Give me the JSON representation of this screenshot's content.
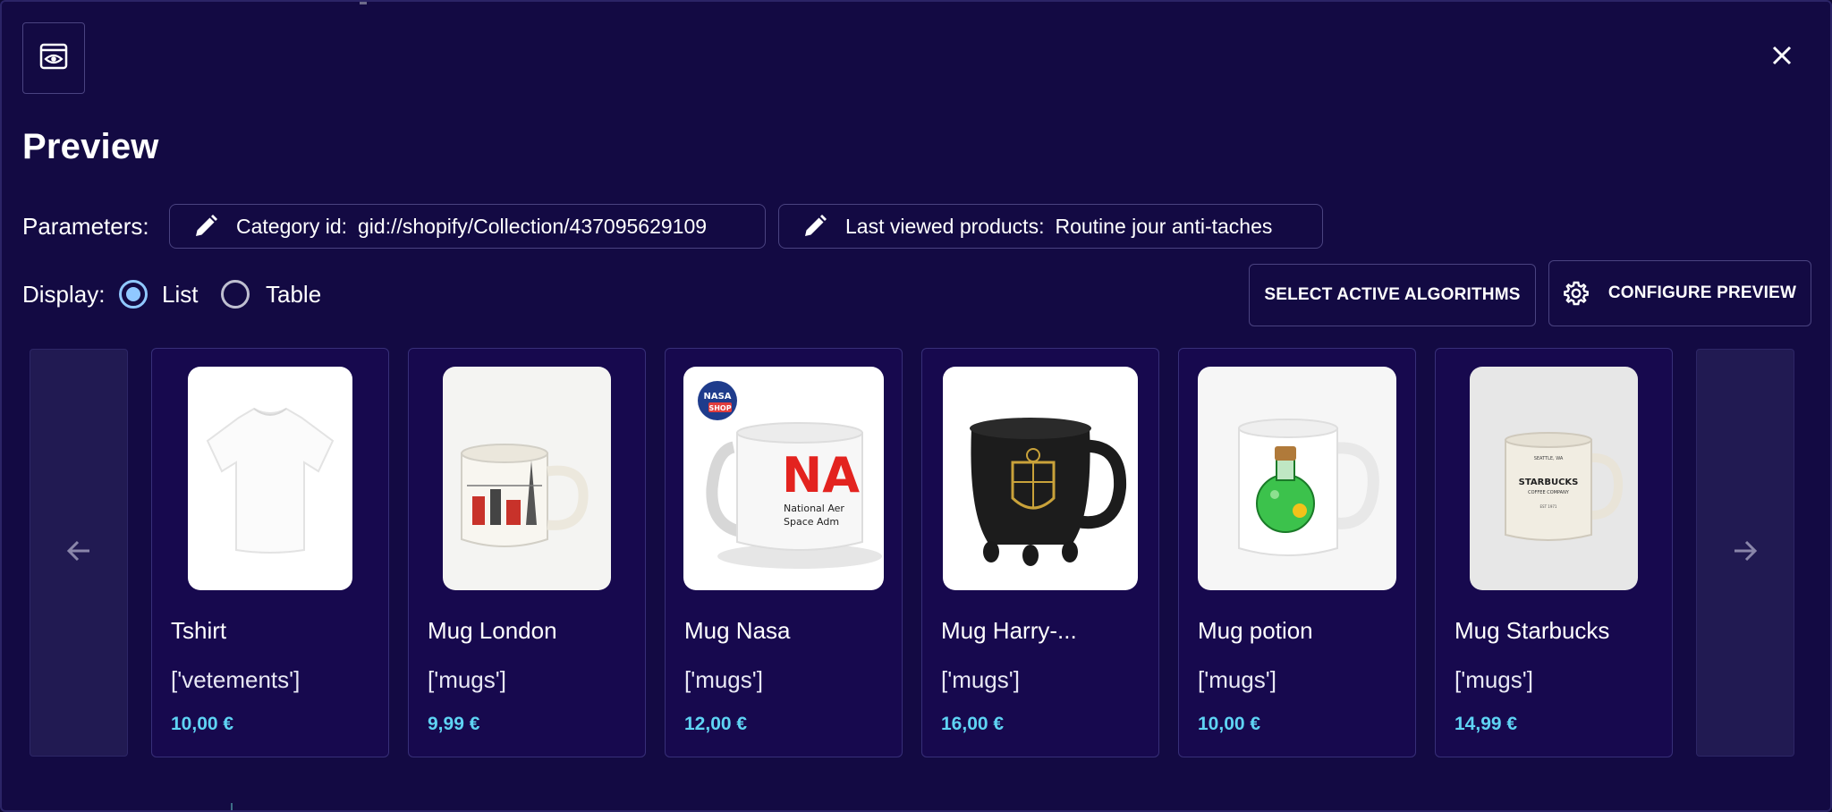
{
  "header": {
    "title": "Preview",
    "eye_icon": "eye-icon",
    "close_icon": "close-icon"
  },
  "parameters": {
    "label": "Parameters:",
    "chips": [
      {
        "key": "Category id:",
        "value": "gid://shopify/Collection/437095629109",
        "icon": "pencil-icon"
      },
      {
        "key": "Last viewed products:",
        "value": "Routine jour anti-taches",
        "icon": "pencil-icon"
      }
    ]
  },
  "display": {
    "label": "Display:",
    "options": [
      {
        "label": "List",
        "selected": true
      },
      {
        "label": "Table",
        "selected": false
      }
    ]
  },
  "actions": {
    "select_algorithms": "SELECT ACTIVE ALGORITHMS",
    "configure_preview": "CONFIGURE PREVIEW"
  },
  "carousel": {
    "prev_icon": "arrow-left-icon",
    "next_icon": "arrow-right-icon",
    "products": [
      {
        "name": "Tshirt",
        "category": "['vetements']",
        "price": "10,00 €",
        "image": "white-tshirt"
      },
      {
        "name": "Mug London",
        "category": "['mugs']",
        "price": "9,99 €",
        "image": "london-mug"
      },
      {
        "name": "Mug Nasa",
        "category": "['mugs']",
        "price": "12,00 €",
        "image": "nasa-mug"
      },
      {
        "name": "Mug Harry-...",
        "category": "['mugs']",
        "price": "16,00 €",
        "image": "harry-potter-mug"
      },
      {
        "name": "Mug potion",
        "category": "['mugs']",
        "price": "10,00 €",
        "image": "potion-mug"
      },
      {
        "name": "Mug Starbucks",
        "category": "['mugs']",
        "price": "14,99 €",
        "image": "starbucks-mug"
      }
    ]
  },
  "nasa_logo_text": [
    "NASA",
    "SHOP"
  ],
  "nasa_mug_text": [
    "NA",
    "National Aer",
    "Space Adm"
  ],
  "starbucks_mug_text": [
    "SEATTLE, WA",
    "STARBUCKS",
    "COFFEE COMPANY",
    "EST 1971"
  ],
  "colors": {
    "background": "#130a43",
    "card": "#17094e",
    "border": "#372f78",
    "price": "#5fd4f4",
    "radio_selected": "#90c8ff"
  }
}
